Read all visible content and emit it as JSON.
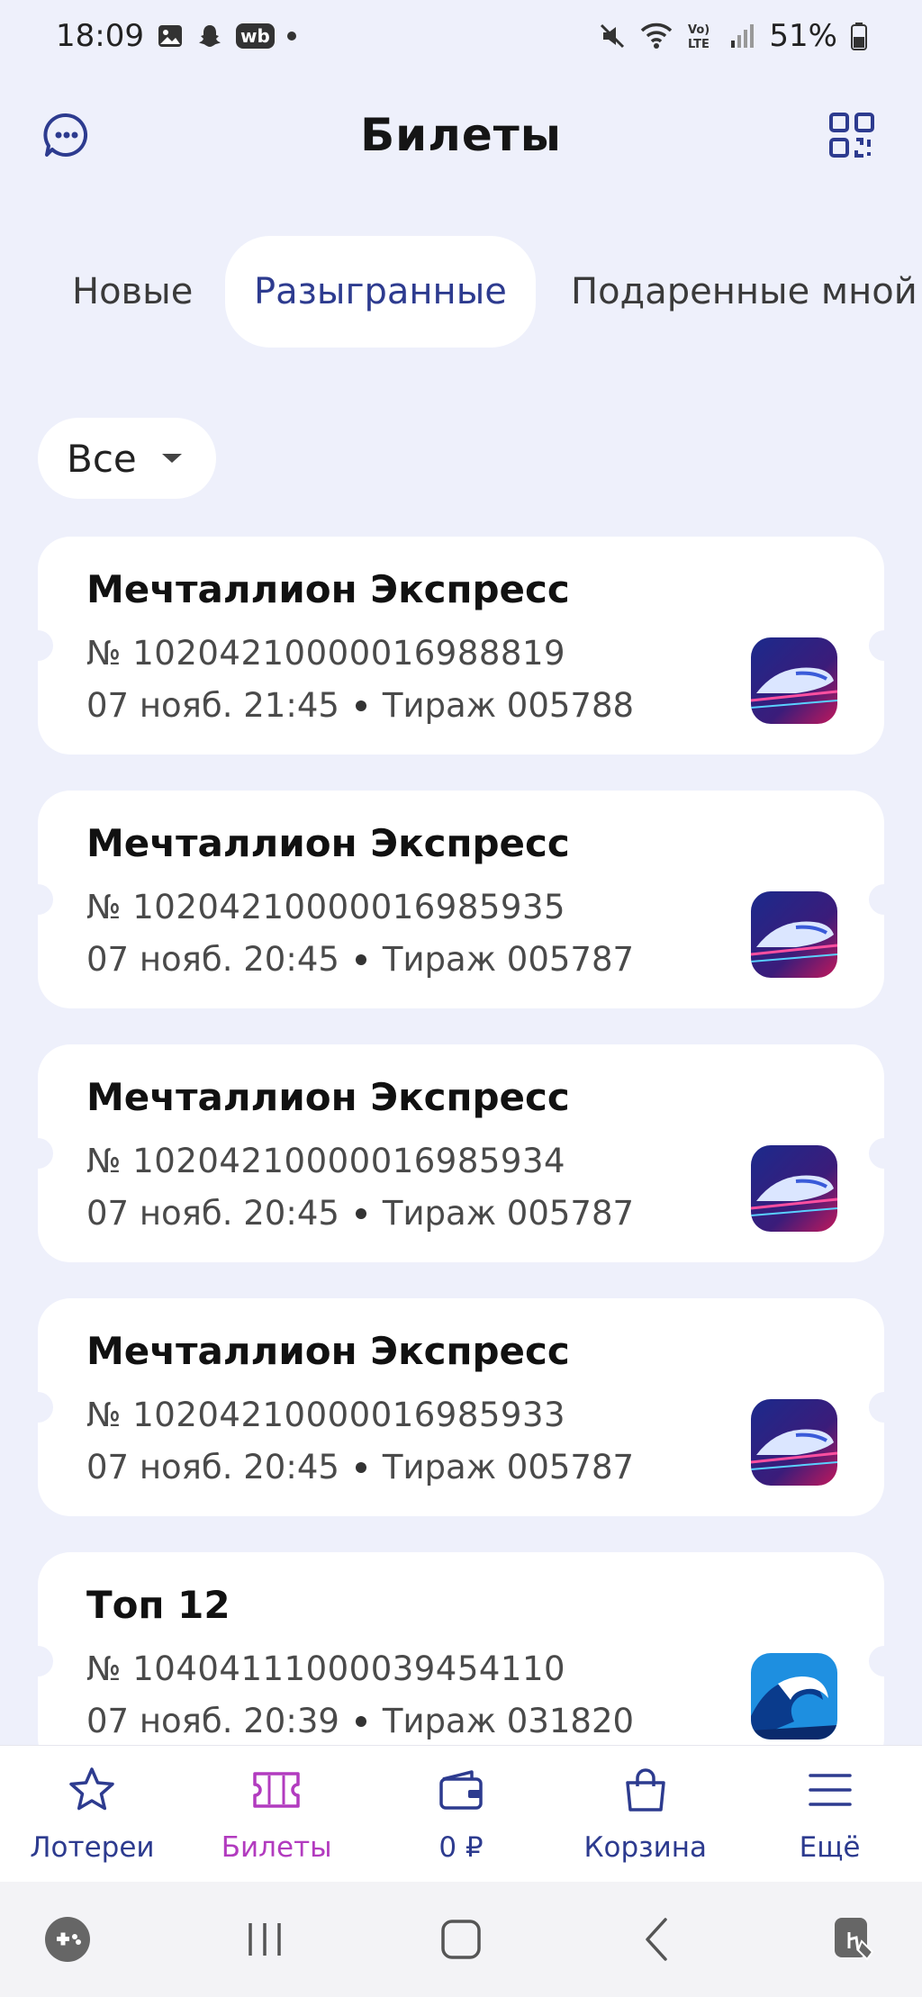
{
  "status_bar": {
    "time": "18:09",
    "wb_badge": "wb",
    "battery": "51%",
    "icons": [
      "image-icon",
      "snapchat-icon",
      "wb-icon",
      "dot-icon",
      "mute-icon",
      "wifi-icon",
      "volte-icon",
      "signal-icon",
      "battery-icon"
    ]
  },
  "header": {
    "title": "Билеты",
    "left_icon": "chat-icon",
    "right_icon": "qr-code-icon"
  },
  "tabs": [
    {
      "label": "Новые",
      "active": false
    },
    {
      "label": "Разыгранные",
      "active": true
    },
    {
      "label": "Подаренные мной",
      "active": false
    }
  ],
  "filter": {
    "value": "Все"
  },
  "tickets": [
    {
      "name": "Мечталлион Экспресс",
      "number": "№ 10204210000016988819",
      "datetime": "07 нояб. 21:45",
      "draw": "Тираж 005788",
      "thumb": "train"
    },
    {
      "name": "Мечталлион Экспресс",
      "number": "№ 10204210000016985935",
      "datetime": "07 нояб. 20:45",
      "draw": "Тираж 005787",
      "thumb": "train"
    },
    {
      "name": "Мечталлион Экспресс",
      "number": "№ 10204210000016985934",
      "datetime": "07 нояб. 20:45",
      "draw": "Тираж 005787",
      "thumb": "train"
    },
    {
      "name": "Мечталлион Экспресс",
      "number": "№ 10204210000016985933",
      "datetime": "07 нояб. 20:45",
      "draw": "Тираж 005787",
      "thumb": "train"
    },
    {
      "name": "Топ 12",
      "number": "№ 10404111000039454110",
      "datetime": "07 нояб. 20:39",
      "draw": "Тираж 031820",
      "thumb": "wave"
    }
  ],
  "bottom_nav": [
    {
      "label": "Лотереи",
      "icon": "star-icon"
    },
    {
      "label": "Билеты",
      "icon": "ticket-icon",
      "active": true
    },
    {
      "label": "0 ₽",
      "icon": "wallet-icon"
    },
    {
      "label": "Корзина",
      "icon": "bag-icon"
    },
    {
      "label": "Ещё",
      "icon": "menu-icon"
    }
  ],
  "colors": {
    "background": "#eef0fb",
    "accent": "#2d3b8f",
    "active_nav": "#b23bbf"
  }
}
